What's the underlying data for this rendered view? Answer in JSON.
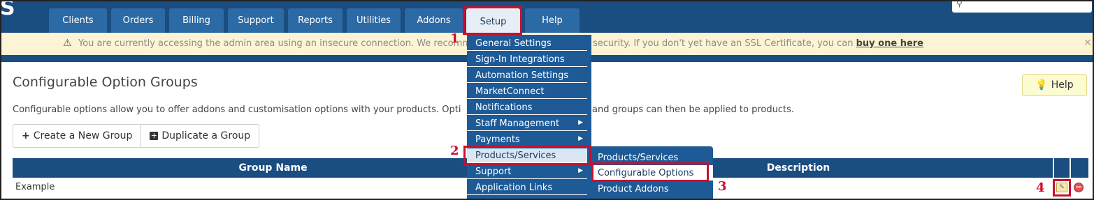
{
  "logo": "S",
  "nav": {
    "tabs": [
      {
        "label": "Clients"
      },
      {
        "label": "Orders"
      },
      {
        "label": "Billing"
      },
      {
        "label": "Support"
      },
      {
        "label": "Reports"
      },
      {
        "label": "Utilities"
      },
      {
        "label": "Addons"
      },
      {
        "label": "Setup",
        "active": true
      },
      {
        "label": "Help"
      }
    ]
  },
  "warning": {
    "text_before": "You are currently accessing the admin area using an insecure connection. We recommend us",
    "text_after": "security. If you don't yet have an SSL Certificate, you can",
    "link": "buy one here",
    "close": "×"
  },
  "page": {
    "title": "Configurable Option Groups",
    "help_label": "Help",
    "description_before": "Configurable options allow you to offer addons and customisation options with your products. Opti",
    "description_after": "and groups can then be applied to products.",
    "create_button": "Create a New Group",
    "duplicate_button": "Duplicate a Group"
  },
  "table": {
    "columns": [
      "Group Name",
      "Description"
    ],
    "rows": [
      {
        "name": "Example",
        "description": ""
      }
    ]
  },
  "setup_menu": {
    "items": [
      {
        "label": "General Settings",
        "submenu": false
      },
      {
        "label": "Sign-In Integrations",
        "submenu": false
      },
      {
        "label": "Automation Settings",
        "submenu": false
      },
      {
        "label": "MarketConnect",
        "submenu": false
      },
      {
        "label": "Notifications",
        "submenu": false
      },
      {
        "label": "Staff Management",
        "submenu": true
      },
      {
        "label": "Payments",
        "submenu": true
      },
      {
        "label": "Products/Services",
        "submenu": true,
        "active": true
      },
      {
        "label": "Support",
        "submenu": true
      },
      {
        "label": "Application Links",
        "submenu": false
      }
    ]
  },
  "products_submenu": {
    "items": [
      {
        "label": "Products/Services"
      },
      {
        "label": "Configurable Options",
        "active": true
      },
      {
        "label": "Product Addons"
      }
    ]
  },
  "steps": [
    "1",
    "2",
    "3",
    "4"
  ],
  "colors": {
    "nav_bg": "#1a4d80",
    "tab_bg": "#2c6aa6",
    "highlight": "#c8102e",
    "warning_bg": "#fcf4d4"
  }
}
